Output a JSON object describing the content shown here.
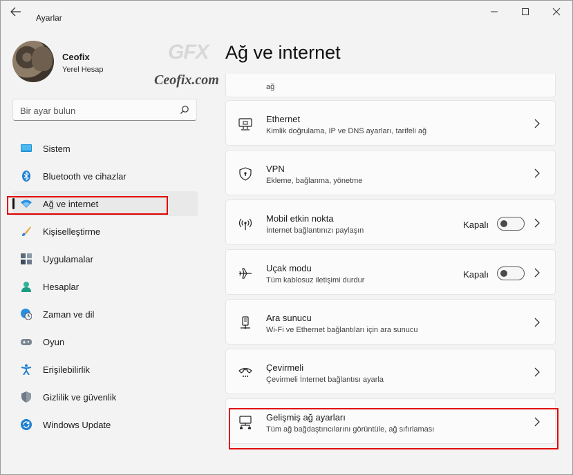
{
  "window": {
    "app_title": "Ayarlar",
    "back_icon": "back-arrow-icon",
    "controls": [
      "minimize-icon",
      "maximize-icon",
      "close-icon"
    ]
  },
  "profile": {
    "name": "Ceofix",
    "account_type": "Yerel Hesap"
  },
  "watermark": {
    "logo": "GFX",
    "text": "Ceofix.com"
  },
  "search": {
    "placeholder": "Bir ayar bulun"
  },
  "sidebar": {
    "items": [
      {
        "label": "Sistem",
        "icon": "monitor-icon",
        "active": false
      },
      {
        "label": "Bluetooth ve cihazlar",
        "icon": "bluetooth-icon",
        "active": false
      },
      {
        "label": "Ağ ve internet",
        "icon": "wifi-icon",
        "active": true
      },
      {
        "label": "Kişiselleştirme",
        "icon": "brush-icon",
        "active": false
      },
      {
        "label": "Uygulamalar",
        "icon": "apps-icon",
        "active": false
      },
      {
        "label": "Hesaplar",
        "icon": "person-icon",
        "active": false
      },
      {
        "label": "Zaman ve dil",
        "icon": "globe-clock-icon",
        "active": false
      },
      {
        "label": "Oyun",
        "icon": "gamepad-icon",
        "active": false
      },
      {
        "label": "Erişilebilirlik",
        "icon": "accessibility-icon",
        "active": false
      },
      {
        "label": "Gizlilik ve güvenlik",
        "icon": "shield-icon",
        "active": false
      },
      {
        "label": "Windows Update",
        "icon": "update-icon",
        "active": false
      }
    ]
  },
  "main": {
    "page_title": "Ağ ve internet",
    "partial_card_subtitle": "ağ",
    "cards": [
      {
        "title": "Ethernet",
        "subtitle": "Kimlik doğrulama, IP ve DNS ayarları, tarifeli ağ",
        "icon": "ethernet-icon"
      },
      {
        "title": "VPN",
        "subtitle": "Ekleme, bağlanma, yönetme",
        "icon": "vpn-shield-icon"
      },
      {
        "title": "Mobil etkin nokta",
        "subtitle": "İnternet bağlantınızı paylaşın",
        "icon": "hotspot-icon",
        "state": "Kapalı"
      },
      {
        "title": "Uçak modu",
        "subtitle": "Tüm kablosuz iletişimi durdur",
        "icon": "airplane-icon",
        "state": "Kapalı"
      },
      {
        "title": "Ara sunucu",
        "subtitle": "Wi-Fi ve Ethernet bağlantıları için ara sunucu",
        "icon": "proxy-icon"
      },
      {
        "title": "Çevirmeli",
        "subtitle": "Çevirmeli İnternet bağlantısı ayarla",
        "icon": "dialup-icon"
      },
      {
        "title": "Gelişmiş ağ ayarları",
        "subtitle": "Tüm ağ bağdaştırıcılarını görüntüle, ağ sıfırlaması",
        "icon": "advanced-network-icon"
      }
    ]
  }
}
